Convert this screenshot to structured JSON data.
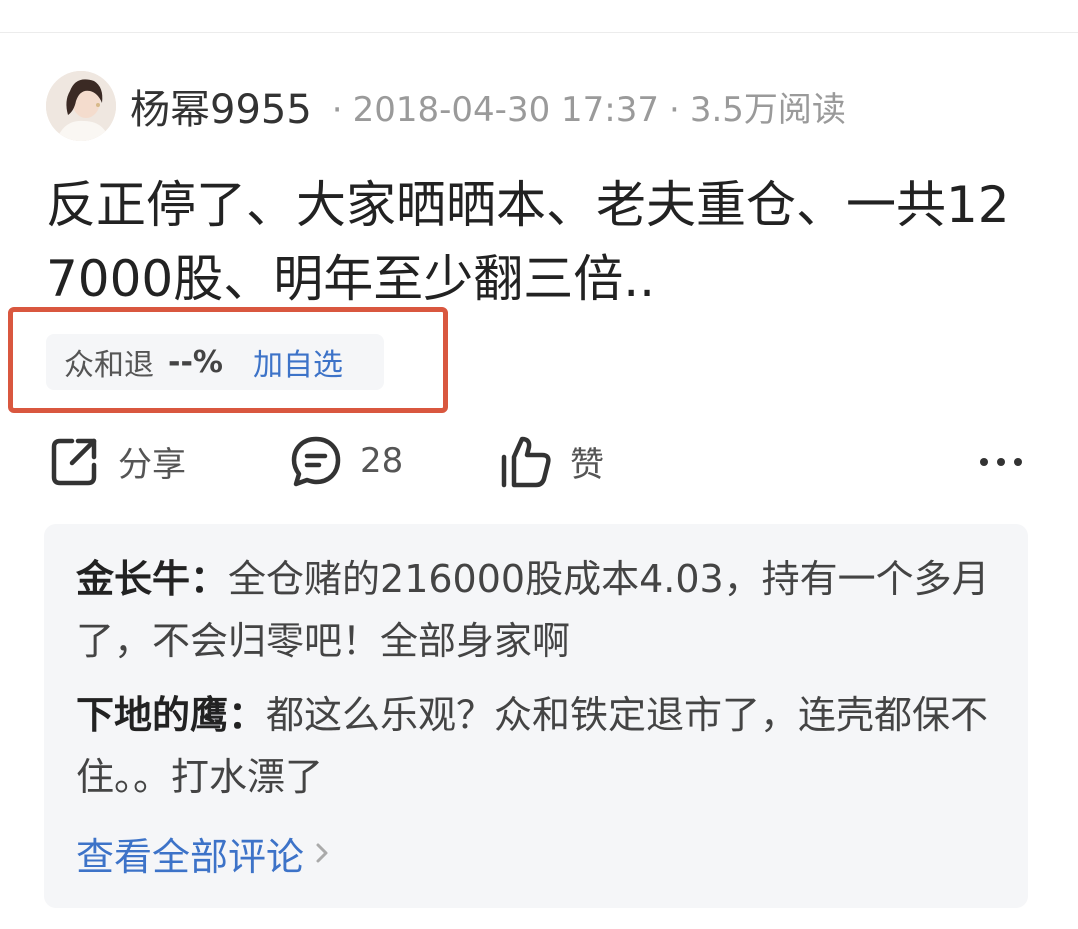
{
  "post": {
    "author": "杨幂9955",
    "date": "2018-04-30 17:37",
    "reads": "3.5万阅读",
    "separator": "·",
    "title": "反正停了、大家晒晒本、老夫重仓、一共127000股、明年至少翻三倍.."
  },
  "stock_tag": {
    "name": "众和退",
    "change": "--%",
    "add_watch": "加自选"
  },
  "actions": {
    "share_label": "分享",
    "comment_count": "28",
    "like_label": "赞"
  },
  "comments": [
    {
      "user": "金长牛：",
      "text": "全仓赌的216000股成本4.03，持有一个多月了，不会归零吧！全部身家啊"
    },
    {
      "user": "下地的鹰：",
      "text": "都这么乐观？众和铁定退市了，连壳都保不住。。打水漂了"
    }
  ],
  "view_all_comments": "查看全部评论",
  "colors": {
    "link_blue": "#3d73c8",
    "highlight_red": "#d9573f",
    "panel_bg": "#f5f6f8"
  },
  "icons": [
    "share-icon",
    "comment-icon",
    "like-icon",
    "more-icon",
    "chevron-right-icon"
  ]
}
